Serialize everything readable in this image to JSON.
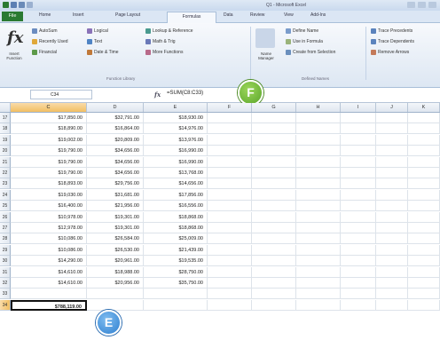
{
  "window": {
    "title": "Q1 - Microsoft Excel"
  },
  "tabs": [
    "File",
    "Home",
    "Insert",
    "Page Layout",
    "Formulas",
    "Data",
    "Review",
    "View",
    "Add-Ins"
  ],
  "active_tab": "Formulas",
  "ribbon": {
    "insert_function": "Insert Function",
    "autosum": "AutoSum",
    "recently_used": "Recently Used",
    "financial": "Financial",
    "logical": "Logical",
    "text": "Text",
    "date_time": "Date & Time",
    "lookup_reference": "Lookup & Reference",
    "math_trig": "Math & Trig",
    "more_functions": "More Functions",
    "function_library": "Function Library",
    "name_manager": "Name Manager",
    "define_name": "Define Name",
    "use_in_formula": "Use in Formula",
    "create_from_selection": "Create from Selection",
    "defined_names": "Defined Names",
    "trace_precedents": "Trace Precedents",
    "trace_dependents": "Trace Dependents",
    "remove_arrows": "Remove Arrows"
  },
  "formula_bar": {
    "name_box": "C34",
    "fx": "fx",
    "formula": "=SUM(C8:C33)"
  },
  "callouts": {
    "f": "F",
    "e": "E"
  },
  "columns": [
    "C",
    "D",
    "E",
    "F",
    "G",
    "H",
    "I",
    "J",
    "K"
  ],
  "rows": [
    {
      "num": "17",
      "c": "$17,850.00",
      "d": "$32,791.00",
      "e": "$18,930.00"
    },
    {
      "num": "18",
      "c": "$18,890.00",
      "d": "$16,864.00",
      "e": "$14,976.00"
    },
    {
      "num": "19",
      "c": "$19,002.00",
      "d": "$20,809.00",
      "e": "$13,976.00"
    },
    {
      "num": "20",
      "c": "$19,790.00",
      "d": "$34,656.00",
      "e": "$16,990.00"
    },
    {
      "num": "21",
      "c": "$19,790.00",
      "d": "$34,656.00",
      "e": "$16,990.00"
    },
    {
      "num": "22",
      "c": "$19,790.00",
      "d": "$34,656.00",
      "e": "$13,768.00"
    },
    {
      "num": "23",
      "c": "$18,893.00",
      "d": "$29,756.00",
      "e": "$14,656.00"
    },
    {
      "num": "24",
      "c": "$19,030.00",
      "d": "$31,681.00",
      "e": "$17,856.00"
    },
    {
      "num": "25",
      "c": "$16,400.00",
      "d": "$21,956.00",
      "e": "$16,556.00"
    },
    {
      "num": "26",
      "c": "$10,978.00",
      "d": "$19,301.00",
      "e": "$18,868.00"
    },
    {
      "num": "27",
      "c": "$12,978.00",
      "d": "$19,301.00",
      "e": "$18,868.00"
    },
    {
      "num": "28",
      "c": "$10,086.00",
      "d": "$26,584.00",
      "e": "$25,009.00"
    },
    {
      "num": "29",
      "c": "$10,086.00",
      "d": "$26,530.00",
      "e": "$21,439.00"
    },
    {
      "num": "30",
      "c": "$14,290.00",
      "d": "$20,961.00",
      "e": "$19,535.00"
    },
    {
      "num": "31",
      "c": "$14,610.00",
      "d": "$18,988.00",
      "e": "$28,750.00"
    },
    {
      "num": "32",
      "c": "$14,610.00",
      "d": "$20,956.00",
      "e": "$35,750.00"
    },
    {
      "num": "33",
      "c": "",
      "d": "",
      "e": ""
    },
    {
      "num": "34",
      "c": "$788,119.00",
      "d": "",
      "e": ""
    }
  ],
  "colors": {
    "excel_green": "#2a7a32",
    "selection_header": "#f2bf62",
    "callout_green": "#5aa52a",
    "callout_blue": "#2f7fd0"
  }
}
